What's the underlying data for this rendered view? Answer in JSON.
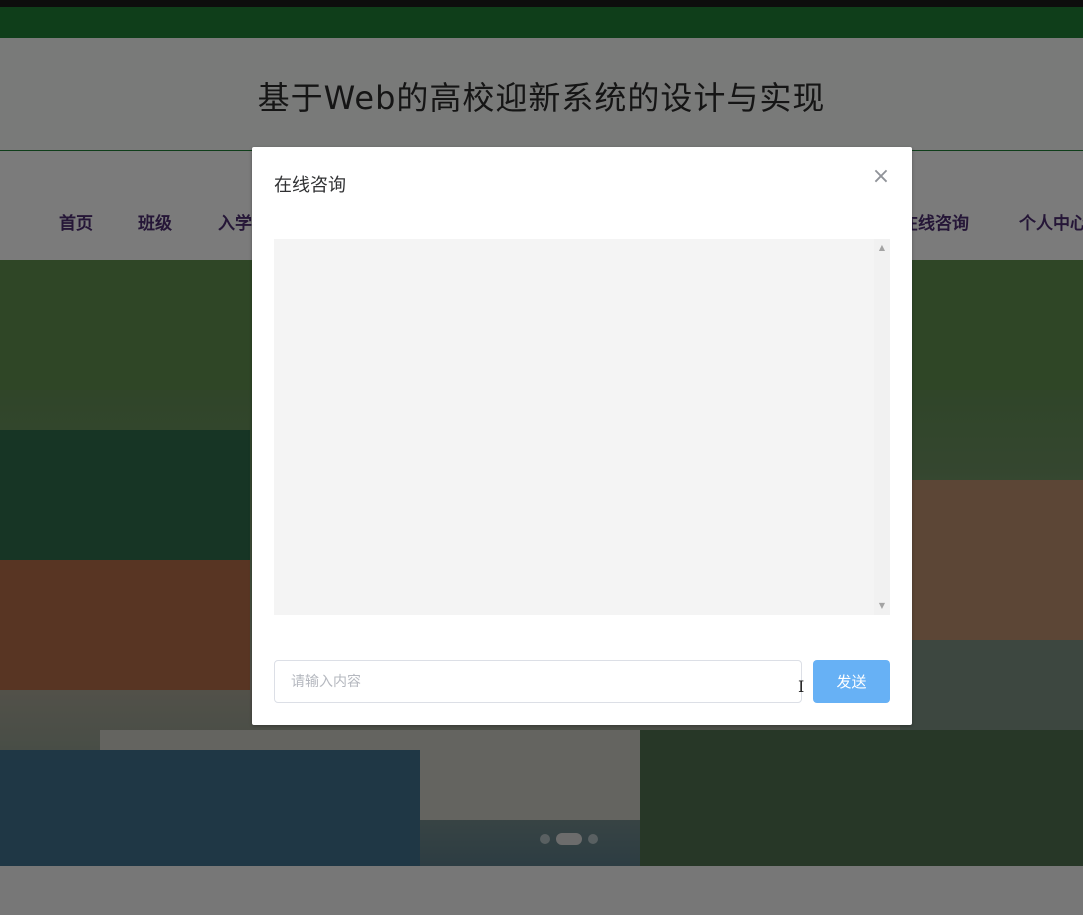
{
  "site": {
    "title": "基于Web的高校迎新系统的设计与实现"
  },
  "nav": {
    "items": [
      {
        "label": "首页"
      },
      {
        "label": "班级"
      },
      {
        "label": "入学"
      },
      {
        "label": "在线咨询"
      },
      {
        "label": "个人中心"
      }
    ]
  },
  "dialog": {
    "title": "在线咨询",
    "close_icon": "close-icon",
    "chat_messages": [],
    "input": {
      "value": "",
      "placeholder": "请输入内容"
    },
    "send_label": "发送"
  },
  "carousel": {
    "active_index": 1,
    "total": 3
  },
  "colors": {
    "accent_green": "#1e7d34",
    "nav_text": "#4a2d6e",
    "send_button": "#67b1f5"
  }
}
